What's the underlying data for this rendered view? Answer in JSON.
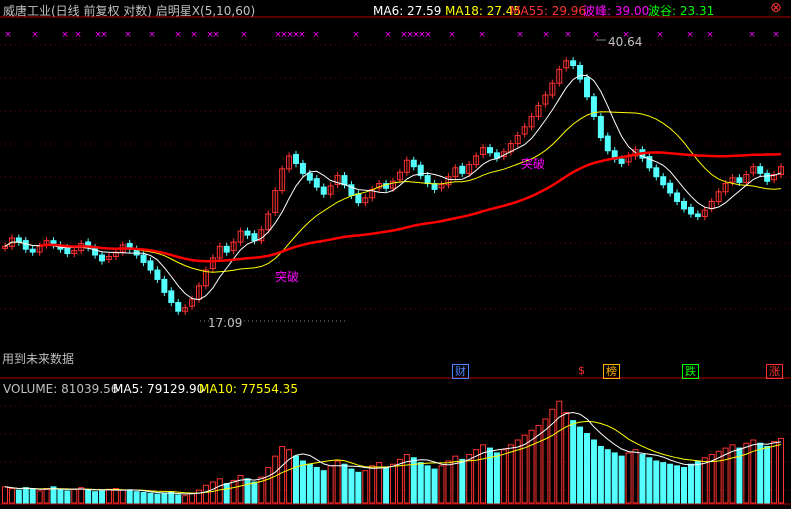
{
  "header": {
    "title": "威唐工业(日线 前复权 对数) 启明星X(5,10,60)",
    "ma6": "MA6: 27.59",
    "ma18": "MA18: 27.45",
    "ma55": "MA55: 29.96",
    "peak": "波峰: 39.00",
    "trough": "波谷: 23.31"
  },
  "labels": {
    "high_price": "40.64",
    "low_price": "17.09",
    "breakout_1": "突破",
    "breakout_2": "突破",
    "future_data": "用到未来数据"
  },
  "markers": {
    "cai": "财",
    "dollar": "$",
    "bang": "榜",
    "die": "跌",
    "zhang": "涨"
  },
  "volume_header": {
    "volume": "VOLUME: 81039.56",
    "ma5": "MA5: 79129.90",
    "ma10": "MA10: 77554.35"
  },
  "colors": {
    "up": "#ff3232",
    "down": "#54ffff",
    "ma_short": "#ffffff",
    "ma_mid": "#ffff00",
    "ma_long": "#ff0000",
    "magenta": "#ff00ff"
  },
  "chart_data": {
    "type": "candlestick",
    "price_series_approx_closes": [
      21.2,
      21.8,
      21.5,
      21.0,
      20.8,
      21.2,
      21.6,
      21.3,
      21.0,
      20.7,
      20.9,
      21.4,
      21.1,
      20.6,
      20.2,
      20.5,
      20.8,
      21.3,
      21.0,
      20.6,
      20.1,
      19.6,
      19.0,
      18.2,
      17.6,
      17.1,
      17.3,
      17.8,
      18.6,
      19.6,
      20.4,
      21.2,
      20.8,
      21.5,
      22.3,
      22.0,
      21.6,
      22.4,
      23.6,
      25.5,
      27.4,
      28.6,
      27.9,
      27.0,
      26.4,
      25.8,
      25.2,
      25.9,
      26.8,
      26.0,
      25.1,
      24.5,
      24.9,
      25.6,
      26.1,
      25.7,
      26.3,
      27.1,
      28.2,
      27.6,
      26.8,
      26.1,
      25.6,
      26.0,
      26.7,
      27.5,
      27.0,
      27.8,
      28.6,
      29.4,
      28.9,
      28.4,
      29.0,
      29.8,
      30.6,
      31.5,
      32.6,
      33.8,
      35.0,
      36.4,
      38.1,
      39.2,
      38.6,
      36.9,
      34.8,
      32.6,
      30.4,
      29.1,
      28.3,
      27.9,
      28.6,
      29.2,
      28.4,
      27.5,
      26.7,
      26.0,
      25.3,
      24.6,
      24.0,
      23.6,
      23.4,
      23.9,
      24.6,
      25.4,
      26.1,
      26.6,
      26.2,
      26.9,
      27.6,
      27.0,
      26.3,
      26.9,
      27.6
    ]
  },
  "volume_data": {
    "values": [
      20,
      18,
      16,
      19,
      17,
      15,
      18,
      20,
      16,
      15,
      17,
      19,
      16,
      14,
      15,
      17,
      18,
      16,
      15,
      14,
      13,
      12,
      11,
      12,
      14,
      10,
      9,
      12,
      16,
      22,
      26,
      30,
      24,
      28,
      34,
      30,
      26,
      32,
      44,
      58,
      70,
      66,
      58,
      52,
      48,
      44,
      40,
      46,
      52,
      48,
      42,
      38,
      40,
      46,
      50,
      44,
      48,
      54,
      60,
      56,
      50,
      46,
      42,
      46,
      52,
      58,
      54,
      60,
      66,
      72,
      68,
      62,
      66,
      72,
      78,
      84,
      90,
      96,
      104,
      116,
      126,
      112,
      102,
      94,
      86,
      78,
      70,
      66,
      62,
      58,
      62,
      66,
      60,
      56,
      52,
      50,
      48,
      46,
      44,
      48,
      52,
      56,
      60,
      64,
      68,
      72,
      68,
      74,
      78,
      74,
      70,
      76,
      80
    ]
  }
}
